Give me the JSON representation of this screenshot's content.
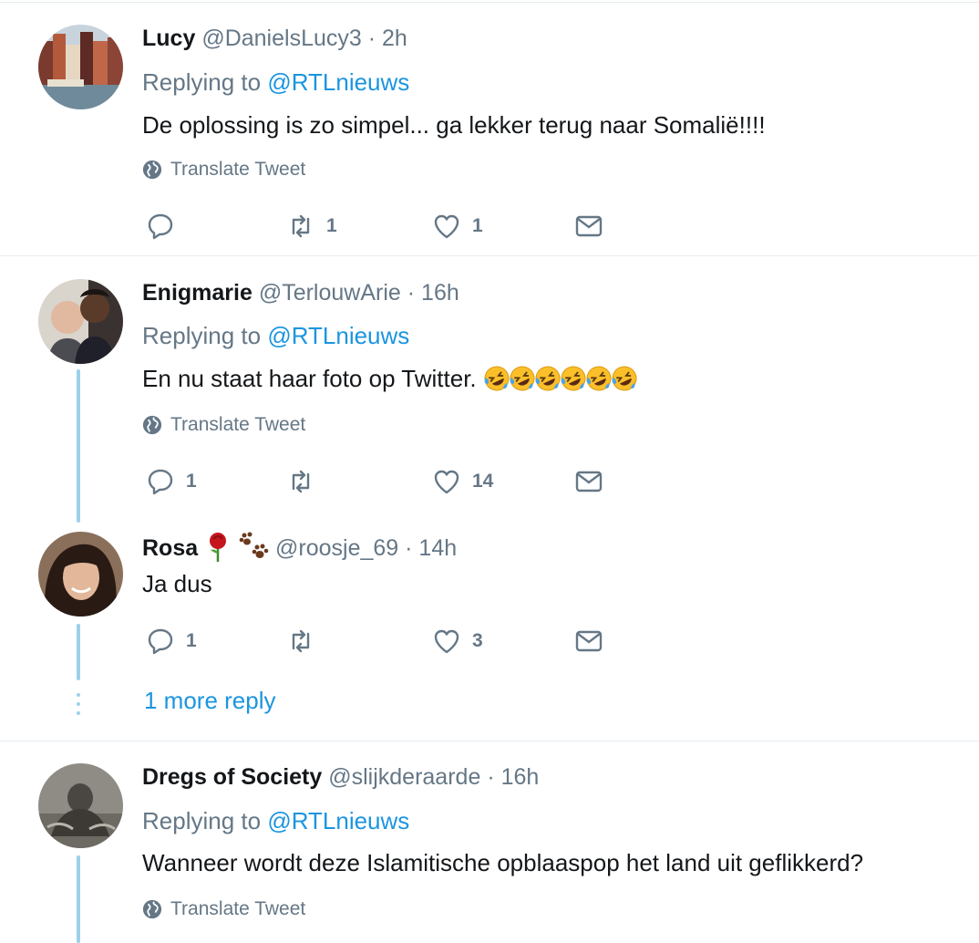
{
  "tweets": [
    {
      "name": "Lucy",
      "handle": "@DanielsLucy3",
      "time": "2h",
      "reply_prefix": "Replying to",
      "reply_to": "@RTLnieuws",
      "text": "De oplossing is zo simpel... ga lekker terug naar Somalië!!!!",
      "translate": "Translate Tweet",
      "replies": "",
      "retweets": "1",
      "likes": "1"
    },
    {
      "name": "Enigmarie",
      "handle": "@TerlouwArie",
      "time": "16h",
      "reply_prefix": "Replying to",
      "reply_to": "@RTLnieuws",
      "text": "En nu staat haar foto op Twitter.",
      "emoji_count": 6,
      "translate": "Translate Tweet",
      "replies": "1",
      "retweets": "",
      "likes": "14"
    },
    {
      "name": "Rosa",
      "handle": "@roosje_69",
      "time": "14h",
      "text": "Ja dus",
      "replies": "1",
      "retweets": "",
      "likes": "3"
    },
    {
      "name": "Dregs of Society",
      "handle": "@slijkderaarde",
      "time": "16h",
      "reply_prefix": "Replying to",
      "reply_to": "@RTLnieuws",
      "text": "Wanneer wordt deze Islamitische opblaaspop het land uit geflikkerd?",
      "translate": "Translate Tweet"
    }
  ],
  "more_reply": "1 more reply",
  "separator": "·",
  "colors": {
    "accent": "#1b95e0",
    "muted": "#657786",
    "thread_line": "#9bd1e8",
    "divider": "#e6ecf0"
  }
}
